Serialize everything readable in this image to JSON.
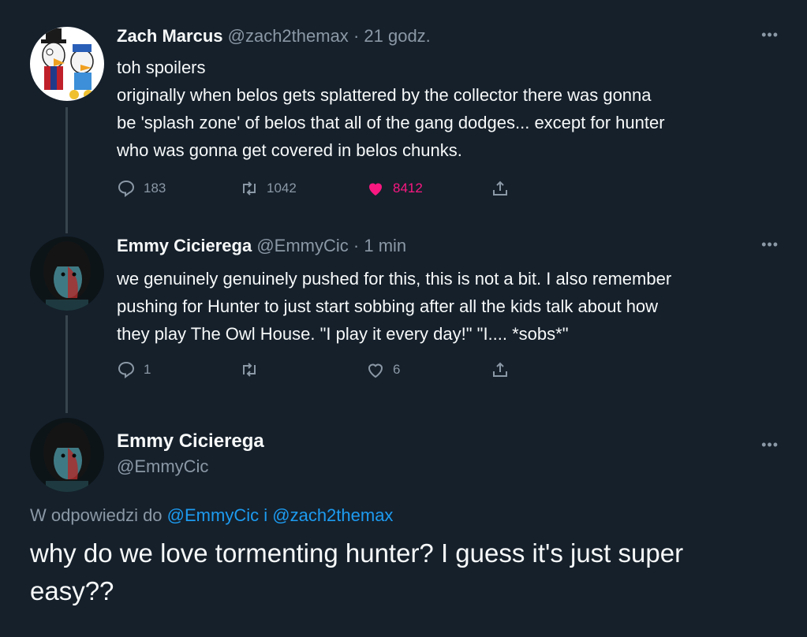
{
  "tweets": [
    {
      "name": "Zach Marcus",
      "handle": "@zach2themax",
      "separator": "·",
      "time": "21 godz.",
      "lines": [
        "toh spoilers",
        "originally when belos gets splattered by the collector there was gonna",
        "be 'splash zone' of belos that all of the gang dodges... except for hunter",
        "who was gonna get covered in belos chunks."
      ],
      "replies": "183",
      "retweets": "1042",
      "likes": "8412",
      "liked": true
    },
    {
      "name": "Emmy Cicierega",
      "handle": "@EmmyCic",
      "separator": "·",
      "time": "1 min",
      "lines": [
        "we genuinely genuinely pushed for this, this is not a bit. I also remember",
        "pushing for Hunter to just start sobbing after all the kids talk about how",
        "they play The Owl House. \"I play it every day!\" \"I.... *sobs*\""
      ],
      "replies": "1",
      "retweets": "",
      "likes": "6",
      "liked": false
    }
  ],
  "main": {
    "name": "Emmy Cicierega",
    "handle": "@EmmyCic",
    "reply_prefix": "W odpowiedzi do",
    "reply_user1": "@EmmyCic",
    "reply_join": "i",
    "reply_user2": "@zach2themax",
    "lines": [
      "why do we love tormenting hunter? I guess it's just super",
      "easy??"
    ]
  },
  "icons": {
    "more": "more-horizontal-icon",
    "reply": "reply-icon",
    "retweet": "retweet-icon",
    "like": "heart-icon",
    "share": "share-icon"
  },
  "colors": {
    "background": "#15202b",
    "secondary_text": "#8b98a5",
    "link": "#1d9bf0",
    "like": "#f91880"
  }
}
